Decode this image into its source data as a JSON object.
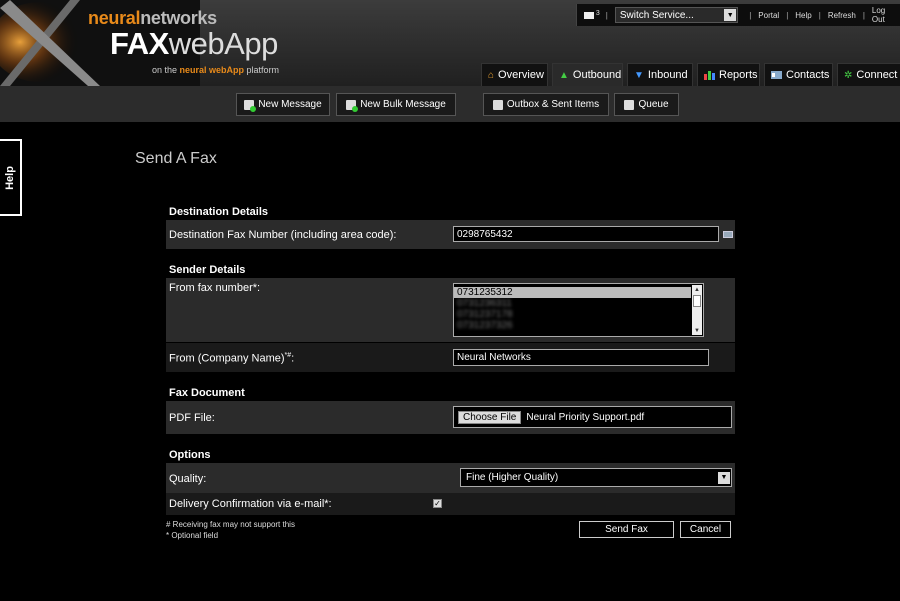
{
  "header": {
    "logo_neural": "neural",
    "logo_networks": "networks",
    "logo_fax": "FAX",
    "logo_webapp": "webApp",
    "logo_tagline_pre": "on the ",
    "logo_tagline_brand": "neural webApp",
    "logo_tagline_post": " platform",
    "message_count": "3",
    "switch_service_label": "Switch Service...",
    "links": {
      "portal": "Portal",
      "help": "Help",
      "refresh": "Refresh",
      "logout": "Log Out"
    },
    "separator": "|"
  },
  "tabs": [
    {
      "label": "Overview",
      "icon": "home-icon"
    },
    {
      "label": "Outbound",
      "icon": "up-arrow-icon"
    },
    {
      "label": "Inbound",
      "icon": "down-arrow-icon"
    },
    {
      "label": "Reports",
      "icon": "bar-chart-icon"
    },
    {
      "label": "Contacts",
      "icon": "contact-card-icon"
    },
    {
      "label": "Connect",
      "icon": "gear-icon"
    }
  ],
  "active_tab": "Outbound",
  "toolbar": {
    "new_message": "New Message",
    "new_bulk_message": "New Bulk Message",
    "outbox_sent": "Outbox & Sent Items",
    "queue": "Queue"
  },
  "help_tab": "Help",
  "page_title": "Send A Fax",
  "form": {
    "destination": {
      "section": "Destination Details",
      "fax_label": "Destination Fax Number (including area code):",
      "fax_value": "0298765432"
    },
    "sender": {
      "section": "Sender Details",
      "from_fax_label": "From fax number*:",
      "from_fax_options": [
        "0731235312",
        "0731236311",
        "0731237178",
        "0731237326"
      ],
      "from_fax_selected": "0731235312",
      "company_label": "From (Company Name)",
      "company_sup": "*#",
      "company_colon": ":",
      "company_value": "Neural Networks"
    },
    "document": {
      "section": "Fax Document",
      "pdf_label": "PDF File:",
      "choose_file": "Choose File",
      "file_name": "Neural Priority Support.pdf"
    },
    "options": {
      "section": "Options",
      "quality_label": "Quality:",
      "quality_value": "Fine (Higher Quality)",
      "delivery_label": "Delivery Confirmation via e-mail*:",
      "delivery_checked": true,
      "check_mark": "✓"
    },
    "notes": {
      "receiving": "# Receiving fax may not support this",
      "optional": "* Optional field"
    },
    "send_button": "Send Fax",
    "cancel_button": "Cancel"
  },
  "colors": {
    "logo_accent": "#e88a1a",
    "row_dark": "#2b2b2b",
    "background": "#000000"
  }
}
